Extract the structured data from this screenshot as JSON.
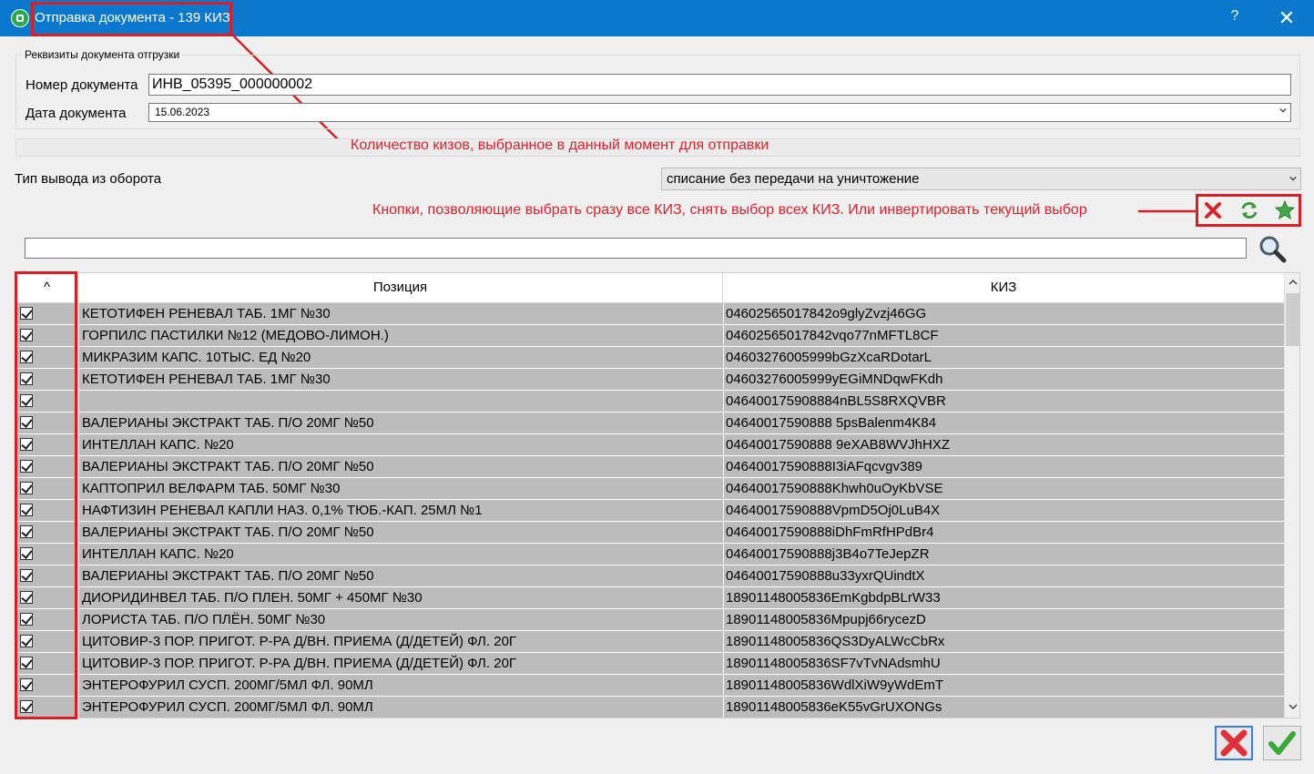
{
  "window": {
    "title": "Отправка документа - 139 КИЗ",
    "help_label": "?",
    "close_label": "✕"
  },
  "details": {
    "group_label": "Реквизиты документа отгрузки",
    "doc_number_label": "Номер документа",
    "doc_number_value": "ИНВ_05395_000000002",
    "doc_date_label": "Дата документа",
    "doc_date_value": "15.06.2023"
  },
  "count_annotation": "Количество кизов, выбранное в данный момент для отправки",
  "withdrawal": {
    "label": "Тип вывода из оборота",
    "value": "списание без передачи на уничтожение"
  },
  "buttons_annotation": "Кнопки, позволяющие выбрать сразу все КИЗ, снять выбор всех КИЗ. Или инвертировать текущий выбор",
  "toolbar": {
    "icons": [
      "deselect-all-icon",
      "invert-selection-icon",
      "select-all-icon"
    ]
  },
  "search": {
    "value": "",
    "icon": "search-icon"
  },
  "table": {
    "headers": {
      "check": "^",
      "position": "Позиция",
      "kiz": "КИЗ"
    },
    "rows": [
      {
        "checked": true,
        "position": "КЕТОТИФЕН РЕНЕВАЛ ТАБ. 1МГ №30",
        "kiz": "04602565017842o9glyZvzj46GG"
      },
      {
        "checked": true,
        "position": "ГОРПИЛС ПАСТИЛКИ №12 (МЕДОВО-ЛИМОН.)",
        "kiz": "04602565017842vqo77nMFTL8CF"
      },
      {
        "checked": true,
        "position": "МИКРАЗИМ КАПС. 10ТЫС. ЕД №20",
        "kiz": "04603276005999bGzXcaRDotarL"
      },
      {
        "checked": true,
        "position": "КЕТОТИФЕН РЕНЕВАЛ ТАБ. 1МГ №30",
        "kiz": "04603276005999yEGiMNDqwFKdh"
      },
      {
        "checked": true,
        "position": "",
        "kiz": "046400175908884nBL5S8RXQVBR"
      },
      {
        "checked": true,
        "position": "ВАЛЕРИАНЫ  ЭКСТРАКТ ТАБ. П/О 20МГ №50",
        "kiz": "04640017590888 5psBalenm4K84"
      },
      {
        "checked": true,
        "position": "ИНТЕЛЛАН КАПС. №20",
        "kiz": "04640017590888 9eXAB8WVJhHXZ"
      },
      {
        "checked": true,
        "position": "ВАЛЕРИАНЫ  ЭКСТРАКТ ТАБ. П/О 20МГ №50",
        "kiz": "04640017590888I3iAFqcvgv389"
      },
      {
        "checked": true,
        "position": "КАПТОПРИЛ ВЕЛФАРМ ТАБ. 50МГ №30",
        "kiz": "04640017590888Khwh0uOyKbVSE"
      },
      {
        "checked": true,
        "position": "НАФТИЗИН РЕНЕВАЛ КАПЛИ НАЗ. 0,1% ТЮБ.-КАП. 25МЛ №1",
        "kiz": "04640017590888VpmD5Oj0LuB4X"
      },
      {
        "checked": true,
        "position": "ВАЛЕРИАНЫ  ЭКСТРАКТ ТАБ. П/О 20МГ №50",
        "kiz": "04640017590888iDhFmRfHPdBr4"
      },
      {
        "checked": true,
        "position": "ИНТЕЛЛАН КАПС. №20",
        "kiz": "04640017590888j3B4o7TeJepZR"
      },
      {
        "checked": true,
        "position": "ВАЛЕРИАНЫ  ЭКСТРАКТ ТАБ. П/О 20МГ №50",
        "kiz": "04640017590888u33yxrQUindtX"
      },
      {
        "checked": true,
        "position": "ДИОРИДИНВЕЛ ТАБ. П/О ПЛЕН. 50МГ + 450МГ №30",
        "kiz": "18901148005836EmKgbdpBLrW33"
      },
      {
        "checked": true,
        "position": "ЛОРИСТА ТАБ. П/О ПЛЁН. 50МГ №30",
        "kiz": "18901148005836Mpupj66rycezD"
      },
      {
        "checked": true,
        "position": "ЦИТОВИР-3 ПОР. ПРИГОТ. Р-РА Д/ВН. ПРИЕМА (Д/ДЕТЕЙ) ФЛ. 20Г",
        "kiz": "18901148005836QS3DyALWcCbRx"
      },
      {
        "checked": true,
        "position": "ЦИТОВИР-3 ПОР. ПРИГОТ. Р-РА Д/ВН. ПРИЕМА (Д/ДЕТЕЙ) ФЛ. 20Г",
        "kiz": "18901148005836SF7vTvNAdsmhU"
      },
      {
        "checked": true,
        "position": "ЭНТЕРОФУРИЛ СУСП. 200МГ/5МЛ ФЛ. 90МЛ",
        "kiz": "18901148005836WdlXiW9yWdEmT"
      },
      {
        "checked": true,
        "position": "ЭНТЕРОФУРИЛ СУСП. 200МГ/5МЛ ФЛ. 90МЛ",
        "kiz": "18901148005836eK55vGrUXONGs"
      }
    ]
  },
  "footer": {
    "cancel_icon": "cancel-icon",
    "ok_icon": "ok-icon"
  },
  "colors": {
    "titlebar": "#0b78d0",
    "annotation": "#e0202a",
    "row_selected": "#bcbcbc"
  }
}
